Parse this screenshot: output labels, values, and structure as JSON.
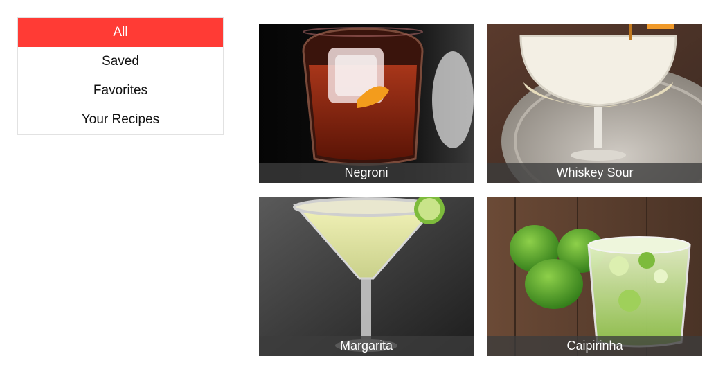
{
  "menu": {
    "items": [
      {
        "label": "All",
        "active": true
      },
      {
        "label": "Saved",
        "active": false
      },
      {
        "label": "Favorites",
        "active": false
      },
      {
        "label": "Your Recipes",
        "active": false
      }
    ],
    "active_color": "#ff3b35"
  },
  "recipes": [
    {
      "name": "Negroni",
      "image": "negroni-glass-photo"
    },
    {
      "name": "Whiskey Sour",
      "image": "whiskey-sour-coupe-photo"
    },
    {
      "name": "Margarita",
      "image": "margarita-glass-photo"
    },
    {
      "name": "Caipirinha",
      "image": "caipirinha-limes-photo"
    }
  ]
}
